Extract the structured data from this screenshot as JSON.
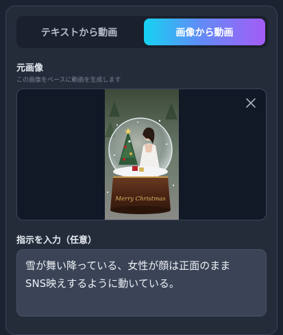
{
  "tabs": [
    {
      "label": "テキストから動画",
      "active": false
    },
    {
      "label": "画像から動画",
      "active": true
    }
  ],
  "source_image": {
    "title": "元画像",
    "subtitle": "この画像をベースに動画を生成します",
    "close_icon": "close-icon",
    "thumbnail_caption": "Merry Christmas"
  },
  "instruction": {
    "label": "指示を入力（任意）",
    "value": "雪が舞い降っている、女性が顔は正面のまま\nSNS映えするように動いている。"
  },
  "colors": {
    "background": "#1c2330",
    "panel": "#242c3a",
    "tab_gradient_start": "#16d3f2",
    "tab_gradient_end": "#a45cf6",
    "textarea_bg": "#3a4456"
  }
}
